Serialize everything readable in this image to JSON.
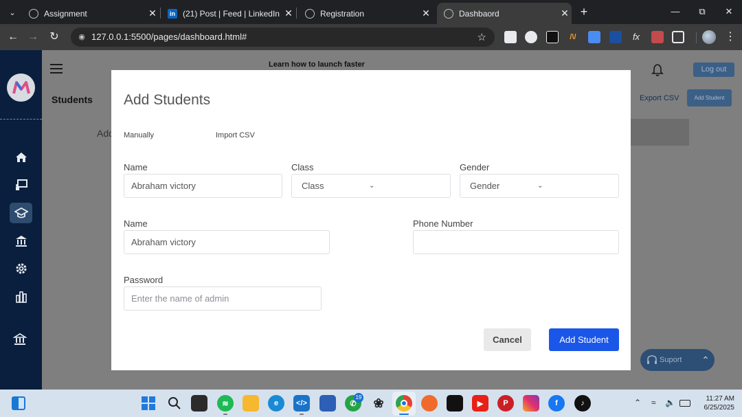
{
  "browser": {
    "tabs": [
      {
        "title": "Assignment",
        "favicon": "globe-icon"
      },
      {
        "title": "(21) Post | Feed | LinkedIn",
        "favicon": "linkedin-icon"
      },
      {
        "title": "Registration",
        "favicon": "globe-icon"
      },
      {
        "title": "Dashbaord",
        "favicon": "globe-icon",
        "active": true
      }
    ],
    "url_host": "127.0.0.1",
    "url_path": ":5500/pages/dashboard.html#"
  },
  "page": {
    "promo_text": "Learn how to launch faster",
    "heading": "Students",
    "breadcrumb_fragment": "Add",
    "logout_label": "Log out",
    "export_label": "Export CSV",
    "add_student_label": "Add Student",
    "support_label": "Suport",
    "sidebar_icons": [
      "home-icon",
      "chalkboard-icon",
      "graduation-cap-icon",
      "bank-icon",
      "gear-icon",
      "chart-icon",
      "institution-icon"
    ]
  },
  "modal": {
    "title": "Add Students",
    "tabs": {
      "manual": "Manually",
      "import": "Import CSV"
    },
    "fields": {
      "name1": {
        "label": "Name",
        "value": "Abraham victory"
      },
      "class": {
        "label": "Class",
        "value": "Class"
      },
      "gender": {
        "label": "Gender",
        "value": "Gender"
      },
      "name2": {
        "label": "Name",
        "value": "Abraham victory"
      },
      "phone": {
        "label": "Phone Number",
        "value": ""
      },
      "password": {
        "label": "Password",
        "placeholder": "Enter the name of admin"
      }
    },
    "cancel_label": "Cancel",
    "submit_label": "Add Student"
  },
  "taskbar": {
    "apps": [
      "windows-start-icon",
      "search-icon",
      "task-view-icon",
      "spotify-icon",
      "file-explorer-icon",
      "edge-icon",
      "vscode-icon",
      "store-icon",
      "whatsapp-icon",
      "chatgpt-icon",
      "chrome-icon",
      "firefox-icon",
      "capcut-icon",
      "youtube-icon",
      "pinterest-icon",
      "instagram-icon",
      "facebook-icon",
      "tiktok-icon"
    ],
    "whatsapp_badge": "19",
    "time": "11:27 AM",
    "date": "6/25/2025"
  },
  "colors": {
    "primary": "#1a56e8",
    "sidebar": "#0a1f3d",
    "overlay": "#7f7f7f"
  }
}
